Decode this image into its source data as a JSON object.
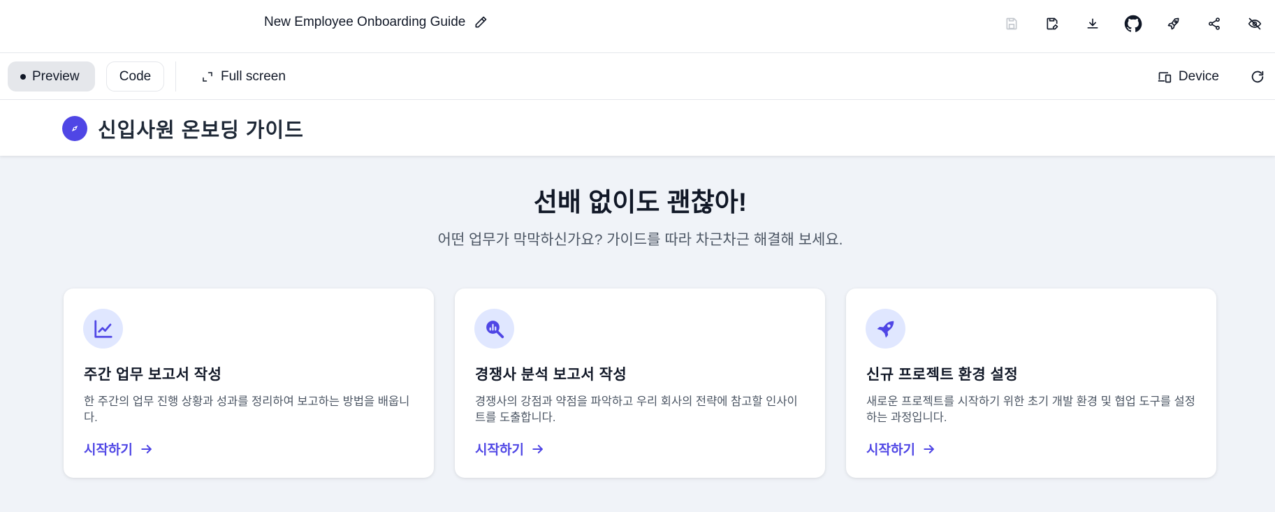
{
  "app": {
    "doc_title": "New Employee Onboarding Guide",
    "top_icons": [
      "save-icon",
      "save-as-icon",
      "download-icon",
      "github-icon",
      "rocket-deploy-icon",
      "share-icon",
      "hide-icon"
    ]
  },
  "toolbar": {
    "preview_label": "Preview",
    "code_label": "Code",
    "fullscreen_label": "Full screen",
    "device_label": "Device"
  },
  "site": {
    "brand_name": "신입사원 온보딩 가이드",
    "accent_color": "#4f46e5"
  },
  "hero": {
    "title": "선배 없이도 괜찮아!",
    "subtitle": "어떤 업무가 막막하신가요? 가이드를 따라 차근차근 해결해 보세요."
  },
  "cards": [
    {
      "icon": "line-chart-icon",
      "title": "주간 업무 보고서 작성",
      "description": "한 주간의 업무 진행 상황과 성과를 정리하여 보고하는 방법을 배웁니다.",
      "link": "시작하기"
    },
    {
      "icon": "search-chart-icon",
      "title": "경쟁사 분석 보고서 작성",
      "description": "경쟁사의 강점과 약점을 파악하고 우리 회사의 전략에 참고할 인사이트를 도출합니다.",
      "link": "시작하기"
    },
    {
      "icon": "rocket-icon",
      "title": "신규 프로젝트 환경 설정",
      "description": "새로운 프로젝트를 시작하기 위한 초기 개발 환경 및 협업 도구를 설정하는 과정입니다.",
      "link": "시작하기"
    }
  ]
}
